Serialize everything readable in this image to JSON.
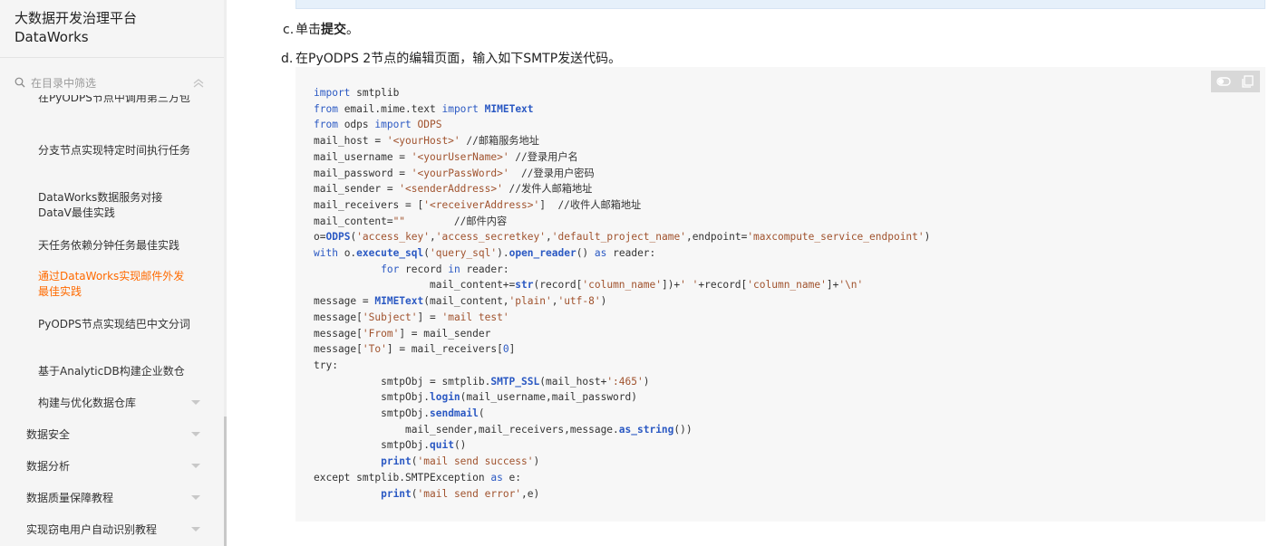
{
  "sidebar": {
    "title": "大数据开发治理平台",
    "subtitle": "DataWorks",
    "filter_placeholder": "在目录中筛选",
    "items": [
      {
        "label": "在PyODPS节点中调用第三方包",
        "level": "sub"
      },
      {
        "label": "分支节点实现特定时间执行任务",
        "level": "sub"
      },
      {
        "label": "DataWorks数据服务对接DataV最佳实践",
        "level": "sub"
      },
      {
        "label": "天任务依赖分钟任务最佳实践",
        "level": "sub"
      },
      {
        "label": "通过DataWorks实现邮件外发最佳实践",
        "level": "sub",
        "active": true
      },
      {
        "label": "PyODPS节点实现结巴中文分词",
        "level": "sub"
      },
      {
        "label": "基于AnalyticDB构建企业数仓",
        "level": "sub"
      },
      {
        "label": "构建与优化数据仓库",
        "level": "sub",
        "expandable": true
      },
      {
        "label": "数据安全",
        "level": "top",
        "expandable": true
      },
      {
        "label": "数据分析",
        "level": "top",
        "expandable": true
      },
      {
        "label": "数据质量保障教程",
        "level": "top",
        "expandable": true
      },
      {
        "label": "实现窃电用户自动识别教程",
        "level": "top",
        "expandable": true
      }
    ]
  },
  "content": {
    "step_c_marker": "c.",
    "step_c_pre": "单击",
    "step_c_bold": "提交",
    "step_c_post": "。",
    "step_d_marker": "d.",
    "step_d_text": "在PyODPS 2节点的编辑页面，输入如下SMTP发送代码。",
    "code_toolbar": [
      "toggle-theme-icon",
      "copy-icon"
    ]
  },
  "colors": {
    "accent": "#ff6a00",
    "keyword": "#2b59c3",
    "string": "#a0522d",
    "code_bg": "#f7f7f7"
  }
}
